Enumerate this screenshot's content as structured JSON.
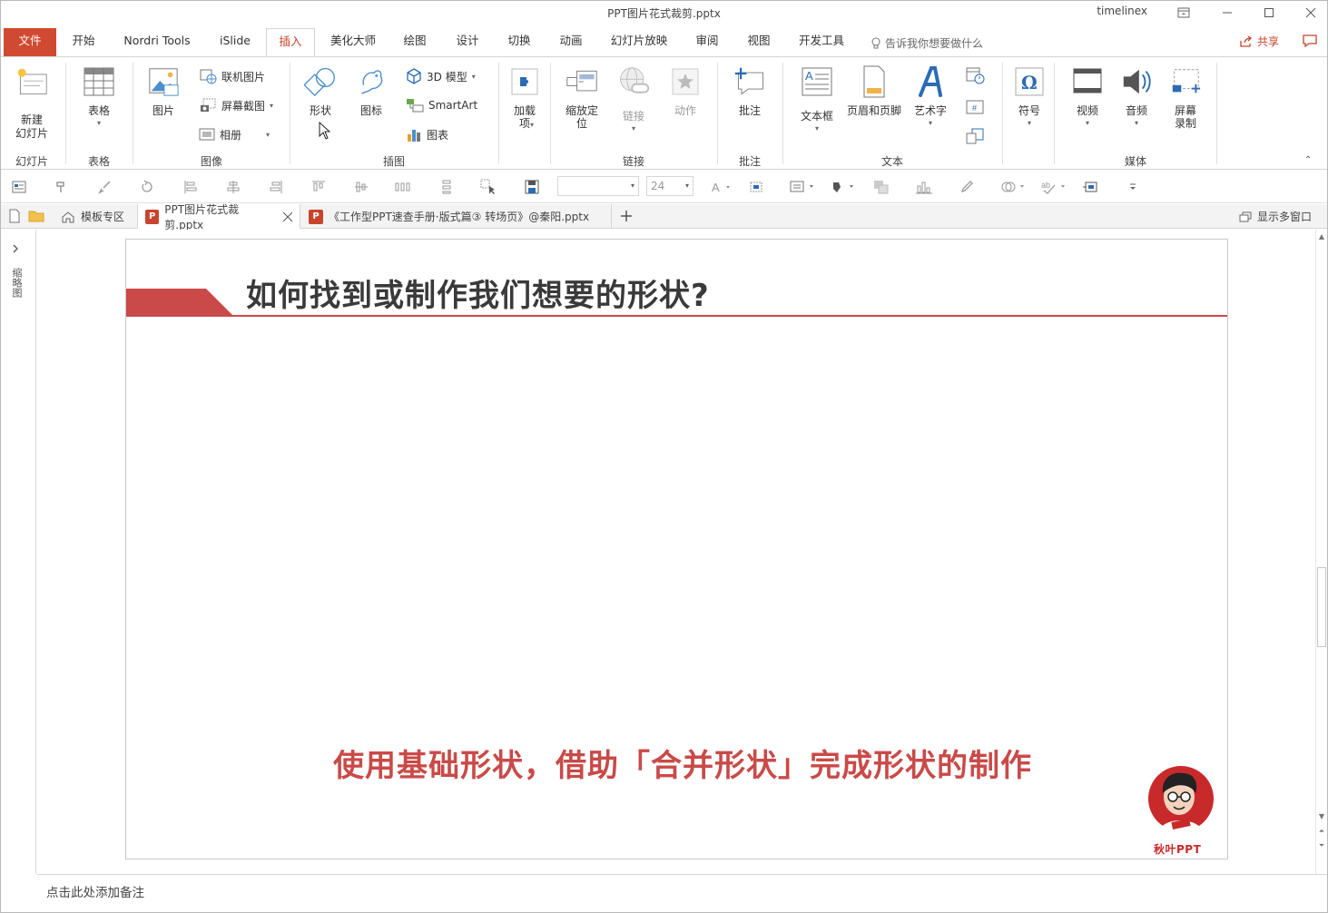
{
  "window": {
    "title": "PPT图片花式裁剪.pptx",
    "user": "timelinex"
  },
  "tabs": {
    "file": "文件",
    "items": [
      "开始",
      "Nordri Tools",
      "iSlide",
      "插入",
      "美化大师",
      "绘图",
      "设计",
      "切换",
      "动画",
      "幻灯片放映",
      "审阅",
      "视图",
      "开发工具"
    ],
    "active": "插入",
    "tell_me": "告诉我你想要做什么",
    "share": "共享"
  },
  "ribbon": {
    "groups": {
      "slides": "幻灯片",
      "table": "表格",
      "images": "图像",
      "illustrations": "插图",
      "links": "链接",
      "comments": "批注",
      "text": "文本",
      "media": "媒体"
    },
    "buttons": {
      "new_slide": "新建\n幻灯片",
      "table": "表格",
      "picture": "图片",
      "online_pictures": "联机图片",
      "screenshot": "屏幕截图",
      "album": "相册",
      "shapes": "形状",
      "icons": "图标",
      "model_3d": "3D 模型",
      "smartart": "SmartArt",
      "chart": "图表",
      "addins": "加载\n项",
      "zoom": "缩放定\n位",
      "link": "链接",
      "action": "动作",
      "comment": "批注",
      "textbox": "文本框",
      "header_footer": "页眉和页脚",
      "wordart": "艺术字",
      "symbol": "符号",
      "video": "视频",
      "audio": "音频",
      "screen_recording": "屏幕\n录制"
    }
  },
  "quick_toolbar": {
    "font_size": "24"
  },
  "doc_tabs": {
    "templates": "模板专区",
    "current_file": "PPT图片花式裁剪.pptx",
    "other_file": "《工作型PPT速查手册·版式篇③ 转场页》@秦阳.pptx",
    "multi_window": "显示多窗口"
  },
  "left_strip": {
    "label": "缩略图"
  },
  "slide": {
    "title": "如何找到或制作我们想要的形状?",
    "subtitle": "使用基础形状，借助「合并形状」完成形状的制作",
    "logo_text": "秋叶PPT"
  },
  "notes": {
    "placeholder": "点击此处添加备注"
  },
  "colors": {
    "accent": "#c94a48",
    "file_tab": "#d04a31",
    "title_text": "#3a3a3a"
  }
}
